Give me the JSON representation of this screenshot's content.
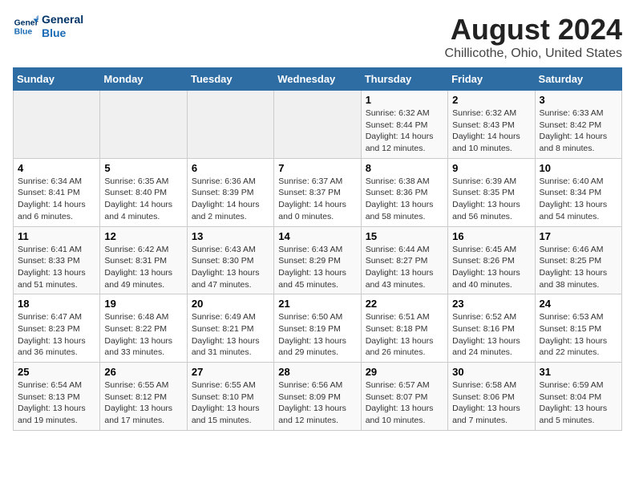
{
  "logo": {
    "line1": "General",
    "line2": "Blue"
  },
  "title": "August 2024",
  "subtitle": "Chillicothe, Ohio, United States",
  "days_of_week": [
    "Sunday",
    "Monday",
    "Tuesday",
    "Wednesday",
    "Thursday",
    "Friday",
    "Saturday"
  ],
  "weeks": [
    [
      {
        "num": "",
        "info": ""
      },
      {
        "num": "",
        "info": ""
      },
      {
        "num": "",
        "info": ""
      },
      {
        "num": "",
        "info": ""
      },
      {
        "num": "1",
        "info": "Sunrise: 6:32 AM\nSunset: 8:44 PM\nDaylight: 14 hours and 12 minutes."
      },
      {
        "num": "2",
        "info": "Sunrise: 6:32 AM\nSunset: 8:43 PM\nDaylight: 14 hours and 10 minutes."
      },
      {
        "num": "3",
        "info": "Sunrise: 6:33 AM\nSunset: 8:42 PM\nDaylight: 14 hours and 8 minutes."
      }
    ],
    [
      {
        "num": "4",
        "info": "Sunrise: 6:34 AM\nSunset: 8:41 PM\nDaylight: 14 hours and 6 minutes."
      },
      {
        "num": "5",
        "info": "Sunrise: 6:35 AM\nSunset: 8:40 PM\nDaylight: 14 hours and 4 minutes."
      },
      {
        "num": "6",
        "info": "Sunrise: 6:36 AM\nSunset: 8:39 PM\nDaylight: 14 hours and 2 minutes."
      },
      {
        "num": "7",
        "info": "Sunrise: 6:37 AM\nSunset: 8:37 PM\nDaylight: 14 hours and 0 minutes."
      },
      {
        "num": "8",
        "info": "Sunrise: 6:38 AM\nSunset: 8:36 PM\nDaylight: 13 hours and 58 minutes."
      },
      {
        "num": "9",
        "info": "Sunrise: 6:39 AM\nSunset: 8:35 PM\nDaylight: 13 hours and 56 minutes."
      },
      {
        "num": "10",
        "info": "Sunrise: 6:40 AM\nSunset: 8:34 PM\nDaylight: 13 hours and 54 minutes."
      }
    ],
    [
      {
        "num": "11",
        "info": "Sunrise: 6:41 AM\nSunset: 8:33 PM\nDaylight: 13 hours and 51 minutes."
      },
      {
        "num": "12",
        "info": "Sunrise: 6:42 AM\nSunset: 8:31 PM\nDaylight: 13 hours and 49 minutes."
      },
      {
        "num": "13",
        "info": "Sunrise: 6:43 AM\nSunset: 8:30 PM\nDaylight: 13 hours and 47 minutes."
      },
      {
        "num": "14",
        "info": "Sunrise: 6:43 AM\nSunset: 8:29 PM\nDaylight: 13 hours and 45 minutes."
      },
      {
        "num": "15",
        "info": "Sunrise: 6:44 AM\nSunset: 8:27 PM\nDaylight: 13 hours and 43 minutes."
      },
      {
        "num": "16",
        "info": "Sunrise: 6:45 AM\nSunset: 8:26 PM\nDaylight: 13 hours and 40 minutes."
      },
      {
        "num": "17",
        "info": "Sunrise: 6:46 AM\nSunset: 8:25 PM\nDaylight: 13 hours and 38 minutes."
      }
    ],
    [
      {
        "num": "18",
        "info": "Sunrise: 6:47 AM\nSunset: 8:23 PM\nDaylight: 13 hours and 36 minutes."
      },
      {
        "num": "19",
        "info": "Sunrise: 6:48 AM\nSunset: 8:22 PM\nDaylight: 13 hours and 33 minutes."
      },
      {
        "num": "20",
        "info": "Sunrise: 6:49 AM\nSunset: 8:21 PM\nDaylight: 13 hours and 31 minutes."
      },
      {
        "num": "21",
        "info": "Sunrise: 6:50 AM\nSunset: 8:19 PM\nDaylight: 13 hours and 29 minutes."
      },
      {
        "num": "22",
        "info": "Sunrise: 6:51 AM\nSunset: 8:18 PM\nDaylight: 13 hours and 26 minutes."
      },
      {
        "num": "23",
        "info": "Sunrise: 6:52 AM\nSunset: 8:16 PM\nDaylight: 13 hours and 24 minutes."
      },
      {
        "num": "24",
        "info": "Sunrise: 6:53 AM\nSunset: 8:15 PM\nDaylight: 13 hours and 22 minutes."
      }
    ],
    [
      {
        "num": "25",
        "info": "Sunrise: 6:54 AM\nSunset: 8:13 PM\nDaylight: 13 hours and 19 minutes."
      },
      {
        "num": "26",
        "info": "Sunrise: 6:55 AM\nSunset: 8:12 PM\nDaylight: 13 hours and 17 minutes."
      },
      {
        "num": "27",
        "info": "Sunrise: 6:55 AM\nSunset: 8:10 PM\nDaylight: 13 hours and 15 minutes."
      },
      {
        "num": "28",
        "info": "Sunrise: 6:56 AM\nSunset: 8:09 PM\nDaylight: 13 hours and 12 minutes."
      },
      {
        "num": "29",
        "info": "Sunrise: 6:57 AM\nSunset: 8:07 PM\nDaylight: 13 hours and 10 minutes."
      },
      {
        "num": "30",
        "info": "Sunrise: 6:58 AM\nSunset: 8:06 PM\nDaylight: 13 hours and 7 minutes."
      },
      {
        "num": "31",
        "info": "Sunrise: 6:59 AM\nSunset: 8:04 PM\nDaylight: 13 hours and 5 minutes."
      }
    ]
  ]
}
